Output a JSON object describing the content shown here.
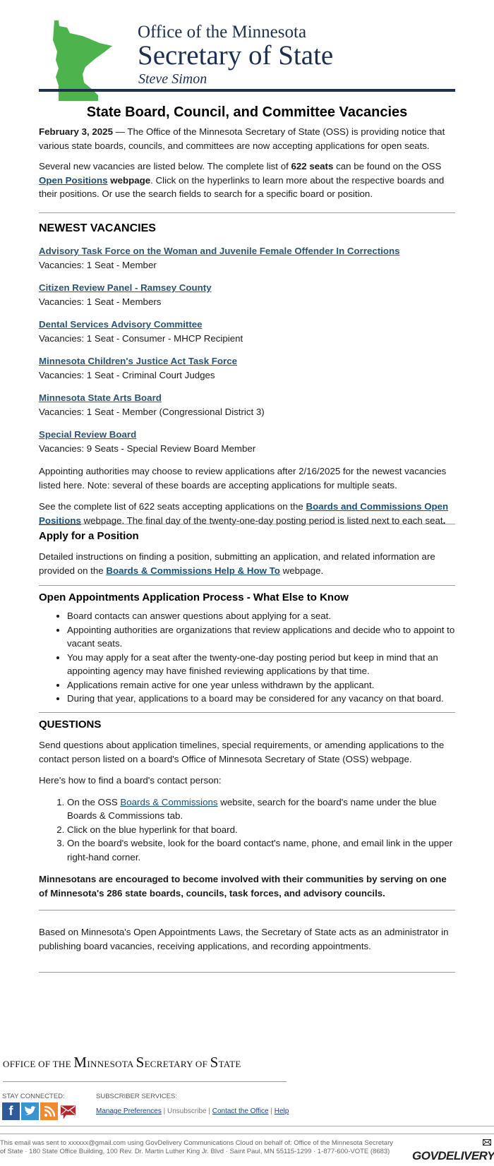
{
  "header": {
    "line1": "Office of the Minnesota",
    "line2": "Secretary of State",
    "line3": "Steve Simon",
    "brand_color": "#1e2f4d",
    "map_color": "#4db34d"
  },
  "title": "State Board, Council, and Committee Vacancies",
  "intro": {
    "date": "February 3, 2025",
    "text": " — The Office of the Minnesota Secretary of State (OSS) is providing notice that various state boards, councils, and committees are now accepting applications for open seats."
  },
  "intro2": {
    "part1": "Several new vacancies are listed below. The complete list of ",
    "seats_bold": "622 seats",
    "part2": " can be found on the OSS ",
    "link": "Open Positions",
    "webpage_bold": " webpage",
    "part3": ". Click on the hyperlinks to learn more about the respective boards and their positions. Or use the search fields to search for a specific board or position."
  },
  "newest": {
    "heading": "NEWEST VACANCIES",
    "items": [
      {
        "name": "Advisory Task Force on the Woman and Juvenile Female Offender In Corrections",
        "vacancies": "Vacancies: 1 Seat - Member"
      },
      {
        "name": "Citizen Review Panel - Ramsey County",
        "vacancies": "Vacancies: 1 Seat - Members"
      },
      {
        "name": "Dental Services Advisory Committee",
        "vacancies": "Vacancies: 1 Seat - Consumer - MHCP Recipient"
      },
      {
        "name": "Minnesota Children's Justice Act Task Force",
        "vacancies": "Vacancies: 1 Seat - Criminal Court Judges"
      },
      {
        "name": "Minnesota State Arts Board",
        "vacancies": "Vacancies: 1 Seat - Member (Congressional District 3)"
      },
      {
        "name": "Special Review Board",
        "vacancies": "Vacancies: 9 Seats - Special Review Board Member"
      }
    ],
    "note": "Appointing authorities may choose to review applications after 2/16/2025 for the newest vacancies listed here. Note: several of these boards are accepting applications for multiple seats.",
    "see_part1": "See the complete list of 622 seats accepting applications on the ",
    "see_link": "Boards and Commissions Open Positions",
    "see_part2": " webpage. The final day of the twenty-one-day posting period is listed next to each seat",
    "see_end": "."
  },
  "apply": {
    "heading": "Apply for a Position",
    "part1": "Detailed instructions on finding a position, submitting an application, and related information are provided on the ",
    "link": "Boards & Commissions Help & How To",
    "part2": " webpage."
  },
  "process": {
    "heading": "Open Appointments Application Process - What Else to Know",
    "bullets": [
      "Board contacts can answer questions about applying for a seat.",
      "Appointing authorities are organizations that review applications and decide who to appoint to vacant seats.",
      "You may apply for a seat after the twenty-one-day posting period but keep in mind that an appointing agency may have finished reviewing applications by that time.",
      "Applications remain active for one year unless withdrawn by the applicant.",
      "During that year, applications to a board may be considered for any vacancy on that board."
    ]
  },
  "questions": {
    "heading": "QUESTIONS",
    "text": "Send questions about application timelines, special requirements, or amending applications to the contact person listed on a board's Office of Minnesota Secretary of State (OSS) webpage.",
    "howto": "Here's how to find a board's contact person:",
    "step1_part1": "On the OSS ",
    "step1_link": "Boards & Commissions",
    "step1_part2": " website, search for the board's name under the blue Boards & Commissions tab.",
    "step2": "Click on the blue hyperlink for that board.",
    "step3": "On the board's website, look for the board contact's name, phone, and email link in the upper right-hand corner.",
    "encourage": "Minnesotans are encouraged to become involved with their communities by serving on one of Minnesota's 286 state boards, councils, task forces, and advisory councils."
  },
  "laws": "Based on Minnesota's Open Appointments Laws, the Secretary of State acts as an administrator in publishing board vacancies, receiving applications, and recording appointments.",
  "footer": {
    "org_small1": "OFFICE OF THE ",
    "org_big1": "M",
    "org_small2": "INNESOTA ",
    "org_big2": "S",
    "org_small3": "ECRETARY OF ",
    "org_big3": "S",
    "org_small4": "TATE",
    "stay_connected": "STAY CONNECTED:",
    "subscriber_services": "SUBSCRIBER SERVICES:",
    "icons": [
      "facebook-icon",
      "twitter-icon",
      "rss-icon",
      "email-icon"
    ],
    "links": {
      "manage": "Manage Preferences",
      "unsubscribe": "Unsubscribe",
      "contact": "Contact the Office",
      "help": "Help",
      "sep": " | "
    },
    "legal": "This email was sent to xxxxxx@gmail.com using GovDelivery Communications Cloud on behalf of: Office of the Minnesota Secretary of State · 180 State Office Building, 100 Rev. Dr. Martin Luther King Jr. Blvd · Saint Paul, MN 55115-1299 · 1-877-600-VOTE (8683)",
    "govdelivery": "GOVDELIVERY"
  }
}
